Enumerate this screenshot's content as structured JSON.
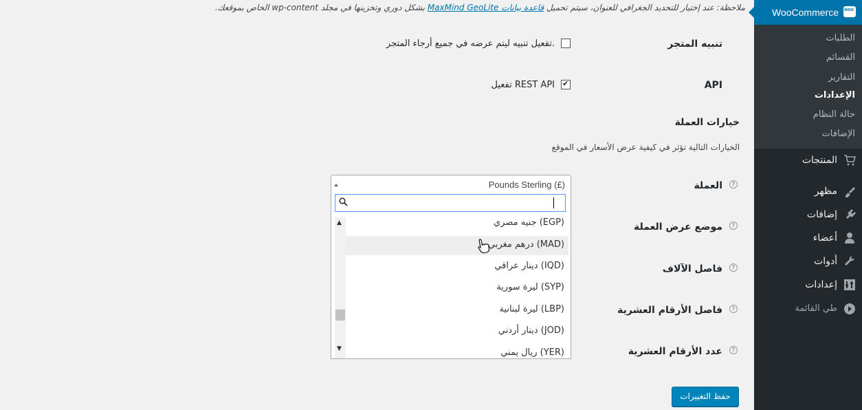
{
  "note": {
    "prefix": "ملاحظة: عند إختيار للتحديد الجغرافي للعنوان، سيتم تحميل",
    "link": "قاعدة بيانات MaxMind GeoLite",
    "suffix": "بشكل دوري وتخزينها في مجلد wp-content الخاص بموقعك."
  },
  "store_notice": {
    "label": "تنبيه المتجر",
    "checkbox_label": "تفعيل تنبيه ليتم عرضه في جميع أرجاء المتجر.",
    "checked": false
  },
  "api": {
    "label": "API",
    "checkbox_label": "تفعيل REST API",
    "checked": true
  },
  "currency_options": {
    "title": "خيارات العملة",
    "description": "الخيارات التالية تؤثر في كيفية عرض الأسعار في الموقع"
  },
  "fields": {
    "currency": "العملة",
    "currency_position": "موضع عرض العملة",
    "thousand_separator": "فاصل الآلاف",
    "decimal_separator": "فاصل الأرقام العشرية",
    "number_of_decimals": "عدد الأرقام العشرية"
  },
  "currency_select": {
    "selected": "Pounds Sterling (£)",
    "search_value": "",
    "options": [
      "جنيه مصري (EGP)",
      "درهم مغربي (MAD)",
      "دينار عراقي (IQD)",
      "ليرة سورية (SYP)",
      "ليرة لبنانية (LBP)",
      "دينار أردني (JOD)",
      "ريال يمني (YER)"
    ],
    "highlighted_index": 1
  },
  "save_button": "حفظ التغييرات",
  "sidebar": {
    "header": "WooCommerce",
    "submenu": [
      "الطلبات",
      "القسائم",
      "التقارير",
      "الإعدادات",
      "حالة النظام",
      "الإضافات"
    ],
    "active_submenu": "الإعدادات",
    "menu": [
      {
        "label": "المنتجات",
        "icon": "cart-icon"
      },
      {
        "label": "مظهر",
        "icon": "brush-icon"
      },
      {
        "label": "إضافات",
        "icon": "plugin-icon"
      },
      {
        "label": "أعضاء",
        "icon": "user-icon"
      },
      {
        "label": "أدوات",
        "icon": "wrench-icon"
      },
      {
        "label": "إعدادات",
        "icon": "settings-icon"
      },
      {
        "label": "طي القائمة",
        "icon": "collapse-icon"
      }
    ]
  },
  "colors": {
    "sidebar_bg": "#23282d",
    "submenu_bg": "#32373c",
    "accent": "#0073aa",
    "button": "#0085ba"
  }
}
